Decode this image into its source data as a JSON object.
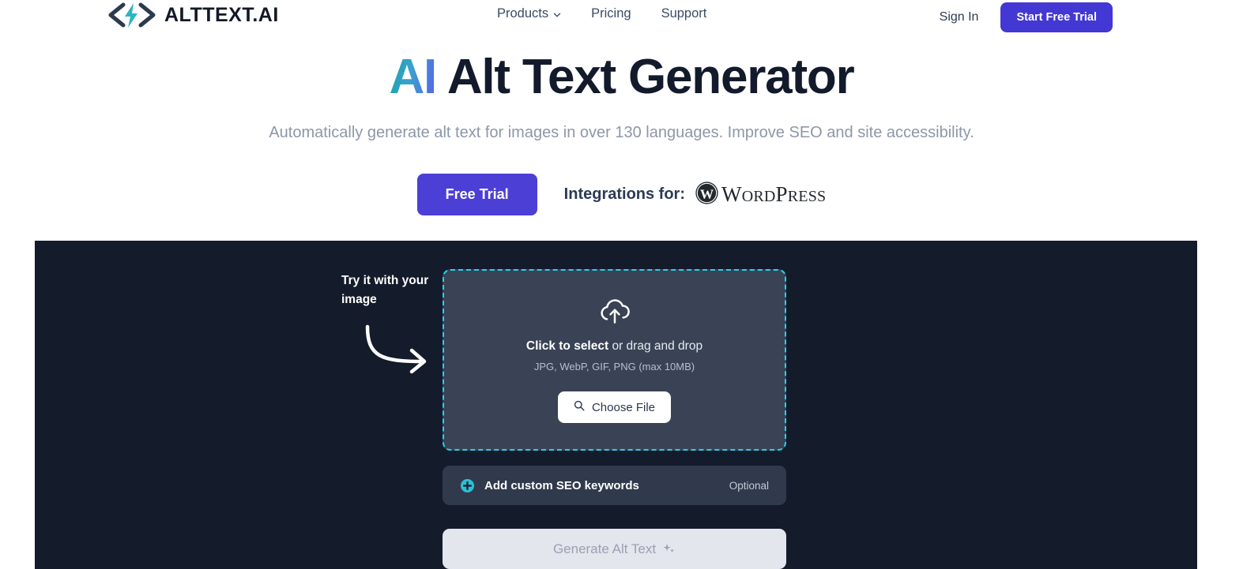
{
  "header": {
    "logo_text": "ALTTEXT.AI",
    "logo_icon": "code-brackets-lightning-icon",
    "nav": [
      {
        "label": "Products",
        "icon": "chevron-down-icon",
        "has_chevron": true
      },
      {
        "label": "Pricing",
        "has_chevron": false
      },
      {
        "label": "Support",
        "has_chevron": false
      }
    ],
    "signin_label": "Sign In",
    "trial_button_label": "Start Free Trial"
  },
  "hero": {
    "title_highlight": "AI",
    "title_rest": "Alt Text Generator",
    "subtitle": "Automatically generate alt text for images in over 130 languages. Improve SEO and site accessibility.",
    "cta_label": "Free Trial",
    "integrations_label": "Integrations for:",
    "integration_name": "WordPress",
    "integration_icon": "wordpress-icon"
  },
  "tool": {
    "try_label": "Try it with your image",
    "arrow_icon": "curved-arrow-right-icon",
    "upload": {
      "icon": "cloud-upload-icon",
      "main_bold": "Click to select",
      "main_rest": " or drag and drop",
      "formats": "JPG, WebP, GIF, PNG (max 10MB)",
      "choose_label": "Choose File",
      "choose_icon": "search-icon"
    },
    "seo": {
      "icon": "plus-circle-icon",
      "label": "Add custom SEO keywords",
      "optional_label": "Optional"
    },
    "generate": {
      "label": "Generate Alt Text",
      "icon": "sparkles-icon"
    }
  },
  "colors": {
    "brand_indigo": "#4338d4",
    "accent_cyan": "#22d3ee",
    "dark_bg": "#141b2b",
    "panel_bg": "#394355",
    "text_dark": "#121a2b"
  }
}
